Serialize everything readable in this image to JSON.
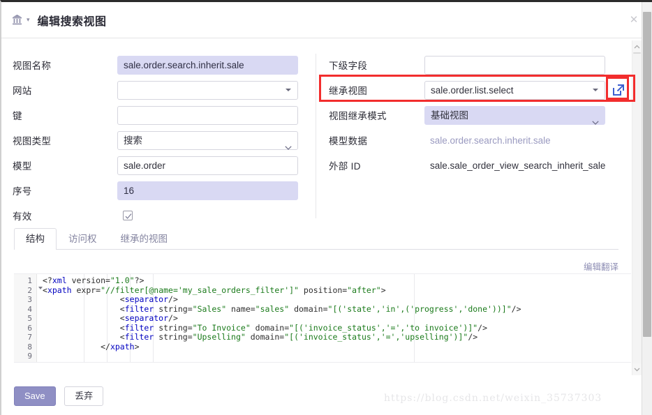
{
  "window": {
    "title": "编辑搜索视图",
    "close_label": "✕",
    "title_caret": "▾",
    "icon": "bank-icon"
  },
  "form": {
    "left": [
      {
        "label": "视图名称",
        "value": "sale.order.search.inherit.sale",
        "type": "input",
        "highlight": true,
        "name": "view-name"
      },
      {
        "label": "网站",
        "value": "",
        "type": "select",
        "highlight": false,
        "name": "website"
      },
      {
        "label": "键",
        "value": "",
        "type": "input",
        "highlight": false,
        "name": "key"
      },
      {
        "label": "视图类型",
        "value": "搜索",
        "type": "dropdown",
        "highlight": false,
        "name": "view-type"
      },
      {
        "label": "模型",
        "value": "sale.order",
        "type": "input",
        "highlight": false,
        "name": "model"
      },
      {
        "label": "序号",
        "value": "16",
        "type": "input",
        "highlight": true,
        "name": "sequence"
      },
      {
        "label": "有效",
        "value": "",
        "type": "checkbox",
        "checked": true,
        "name": "active"
      }
    ],
    "right": [
      {
        "label": "下级字段",
        "value": "",
        "type": "input",
        "highlight": false,
        "name": "child-field"
      },
      {
        "label": "继承视图",
        "value": "sale.order.list.select",
        "type": "select",
        "highlight": false,
        "name": "inherited-view"
      },
      {
        "label": "视图继承模式",
        "value": "基础视图",
        "type": "dropdown",
        "highlight": true,
        "name": "view-inherit-mode"
      },
      {
        "label": "模型数据",
        "value": "sale.order.search.inherit.sale",
        "type": "text-link",
        "highlight": false,
        "name": "model-data"
      },
      {
        "label": "外部 ID",
        "value": "sale.sale_order_view_search_inherit_sale",
        "type": "text",
        "highlight": false,
        "name": "external-id"
      }
    ],
    "external_link_icon": "external-link-icon"
  },
  "tabs": [
    {
      "label": "结构",
      "active": true,
      "name": "architecture"
    },
    {
      "label": "访问权",
      "active": false,
      "name": "access-rights"
    },
    {
      "label": "继承的视图",
      "active": false,
      "name": "inherited-views"
    }
  ],
  "translate_link": "编辑翻译",
  "editor": {
    "line_numbers": [
      "1",
      "2",
      "3",
      "4",
      "5",
      "6",
      "7",
      "8",
      "9"
    ],
    "fold_line": 2,
    "lines": [
      "<?xml version=\"1.0\"?>",
      "<xpath expr=\"//filter[@name='my_sale_orders_filter']\" position=\"after\">",
      "                <separator/>",
      "                <filter string=\"Sales\" name=\"sales\" domain=\"[('state','in',('progress','done'))]\"/>",
      "                <separator/>",
      "                <filter string=\"To Invoice\" domain=\"[('invoice_status','=','to invoice')]\"/>",
      "                <filter string=\"Upselling\" domain=\"[('invoice_status','=','upselling')]\"/>",
      "            </xpath>",
      ""
    ]
  },
  "footer": {
    "save_label": "Save",
    "discard_label": "丢弃"
  },
  "watermark": "https://blog.csdn.net/weixin_35737303",
  "colors": {
    "highlight_field": "#d9d9f3",
    "primary_button": "#8f8fc4",
    "annotation_red": "#f22d2d",
    "link": "#8e8eb4"
  }
}
